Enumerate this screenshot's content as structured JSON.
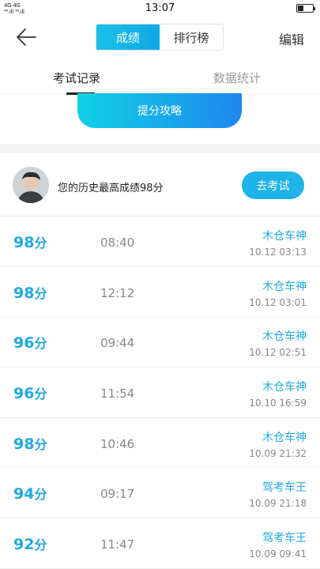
{
  "status_bar": {
    "signal_top": "4G 4G",
    "signal_bottom": "⁴⁶.ıll ¹⁶.ıll",
    "time": "13:07"
  },
  "header": {
    "back_icon": "arrow-left-icon",
    "tabs": [
      {
        "label": "成绩",
        "active": true
      },
      {
        "label": "排行榜",
        "active": false
      }
    ],
    "edit_label": "编辑",
    "accent_color": "#1ea9e0"
  },
  "sub_tabs": [
    {
      "label": "考试记录",
      "active": true
    },
    {
      "label": "数据统计",
      "active": false
    }
  ],
  "strategy_label": "提分攻略",
  "best": {
    "text": "您的历史最高成绩98分",
    "button_label": "去考试"
  },
  "records": [
    {
      "score": "98",
      "unit": "分",
      "duration": "08:40",
      "title": "木仓车神",
      "date": "10.12  03:13"
    },
    {
      "score": "98",
      "unit": "分",
      "duration": "12:12",
      "title": "木仓车神",
      "date": "10.12  03:01"
    },
    {
      "score": "96",
      "unit": "分",
      "duration": "09:44",
      "title": "木仓车神",
      "date": "10.12  02:51"
    },
    {
      "score": "96",
      "unit": "分",
      "duration": "11:54",
      "title": "木仓车神",
      "date": "10.10  16:59"
    },
    {
      "score": "98",
      "unit": "分",
      "duration": "10:46",
      "title": "木仓车神",
      "date": "10.09  21:32"
    },
    {
      "score": "94",
      "unit": "分",
      "duration": "09:17",
      "title": "驾考车王",
      "date": "10.09  21:18"
    },
    {
      "score": "92",
      "unit": "分",
      "duration": "11:47",
      "title": "驾考车王",
      "date": "10.09  09:41"
    }
  ]
}
